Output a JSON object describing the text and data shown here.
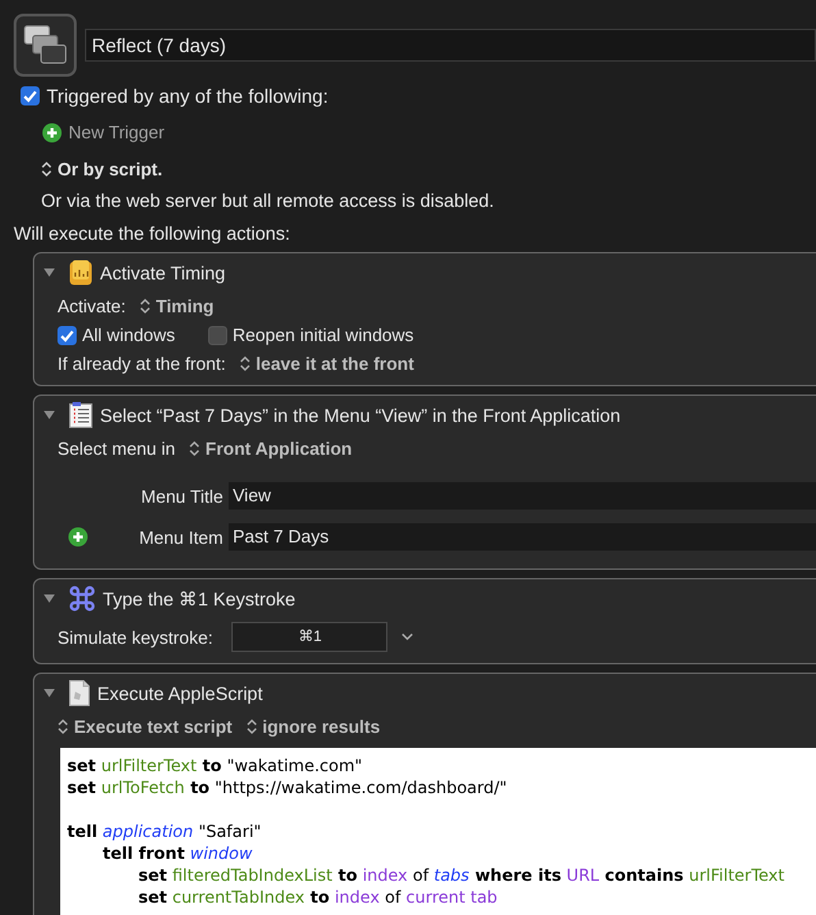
{
  "macro": {
    "name": "Reflect (7 days)"
  },
  "triggers": {
    "enabled": true,
    "label": "Triggered by any of the following:",
    "new_trigger": "New Trigger",
    "script_popup": "Or by script.",
    "web_note": "Or via the web server but all remote access is disabled."
  },
  "actions_heading": "Will execute the following actions:",
  "actions": [
    {
      "kind": "timing",
      "expanded": true,
      "title": "Activate Timing",
      "activate_label": "Activate:",
      "activate_value": "Timing",
      "options": [
        {
          "label": "All windows",
          "checked": true
        },
        {
          "label": "Reopen initial windows",
          "checked": false
        }
      ],
      "front_label": "If already at the front:",
      "front_value": "leave it at the front"
    },
    {
      "kind": "menu",
      "expanded": true,
      "title": "Select “Past 7 Days” in the Menu “View” in the Front Application",
      "select_label": "Select menu in",
      "select_value": "Front Application",
      "fields": [
        {
          "label": "Menu Title",
          "value": "View",
          "addable": false
        },
        {
          "label": "Menu Item",
          "value": "Past 7 Days",
          "addable": true
        }
      ]
    },
    {
      "kind": "keystroke",
      "expanded": true,
      "title": "Type the ⌘1 Keystroke",
      "label": "Simulate keystroke:",
      "value": "⌘1"
    },
    {
      "kind": "applescript",
      "expanded": true,
      "title": "Execute AppleScript",
      "popups": [
        "Execute text script",
        "ignore results"
      ],
      "code": [
        {
          "kind": "code",
          "tokens": [
            {
              "kind": "keyword",
              "text": "set"
            },
            {
              "kind": "variable",
              "text": "urlFilterText"
            },
            {
              "kind": "keyword",
              "text": "to"
            },
            {
              "kind": "plain",
              "text": "\"wakatime.com\""
            }
          ]
        },
        {
          "kind": "code",
          "tokens": [
            {
              "kind": "keyword",
              "text": "set"
            },
            {
              "kind": "variable",
              "text": "urlToFetch"
            },
            {
              "kind": "keyword",
              "text": "to"
            },
            {
              "kind": "plain",
              "text": "\"https://wakatime.com/dashboard/\""
            }
          ]
        },
        {
          "kind": "blank"
        },
        {
          "kind": "code",
          "tokens": [
            {
              "kind": "keyword",
              "text": "tell"
            },
            {
              "kind": "class",
              "text": "application"
            },
            {
              "kind": "plain",
              "text": "\"Safari\""
            }
          ],
          "children": [
            {
              "kind": "code",
              "tokens": [
                {
                  "kind": "keyword",
                  "text": "tell front"
                },
                {
                  "kind": "class",
                  "text": "window"
                }
              ],
              "children": [
                {
                  "kind": "code",
                  "tokens": [
                    {
                      "kind": "keyword",
                      "text": "set"
                    },
                    {
                      "kind": "variable",
                      "text": "filteredTabIndexList"
                    },
                    {
                      "kind": "keyword",
                      "text": "to"
                    },
                    {
                      "kind": "property",
                      "text": "index"
                    },
                    {
                      "kind": "plain",
                      "text": "of"
                    },
                    {
                      "kind": "class",
                      "text": "tabs"
                    },
                    {
                      "kind": "keyword",
                      "text": "where its"
                    },
                    {
                      "kind": "property",
                      "text": "URL"
                    },
                    {
                      "kind": "keyword",
                      "text": "contains"
                    },
                    {
                      "kind": "variable",
                      "text": "urlFilterText"
                    }
                  ]
                },
                {
                  "kind": "code",
                  "tokens": [
                    {
                      "kind": "keyword",
                      "text": "set"
                    },
                    {
                      "kind": "variable",
                      "text": "currentTabIndex"
                    },
                    {
                      "kind": "keyword",
                      "text": "to"
                    },
                    {
                      "kind": "property",
                      "text": "index"
                    },
                    {
                      "kind": "plain",
                      "text": "of"
                    },
                    {
                      "kind": "property",
                      "text": "current tab"
                    }
                  ]
                }
              ]
            }
          ]
        }
      ]
    }
  ]
}
